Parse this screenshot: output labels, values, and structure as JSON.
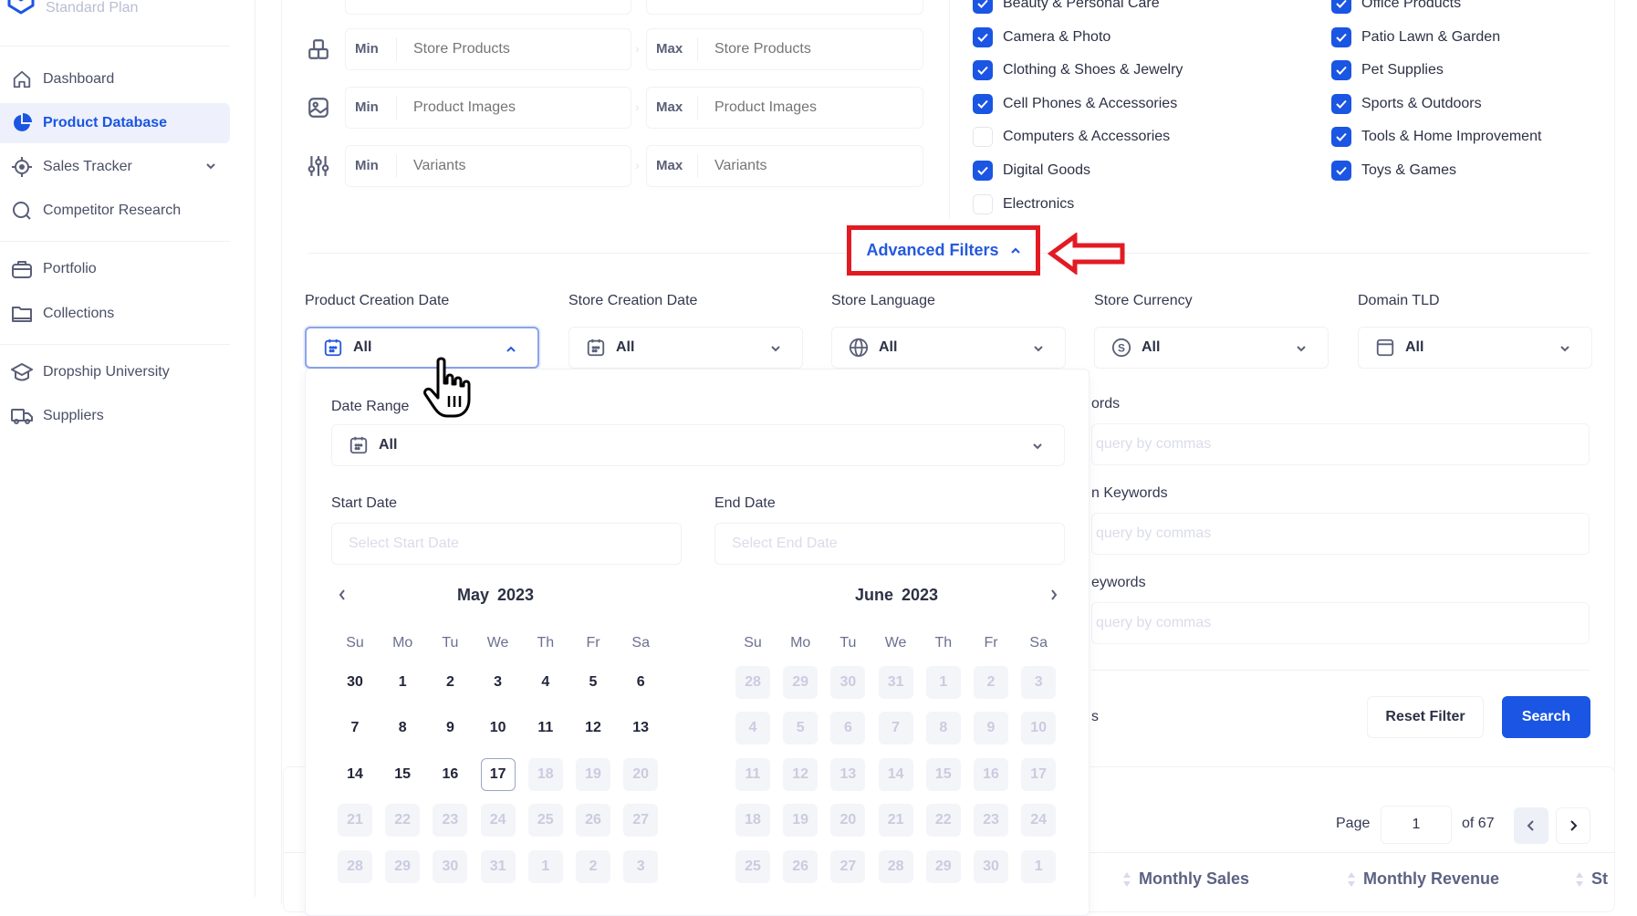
{
  "sidebar": {
    "plan": "Standard Plan",
    "items": [
      {
        "label": "Dashboard",
        "icon": "home-icon"
      },
      {
        "label": "Product Database",
        "icon": "pie-chart-icon",
        "active": true
      },
      {
        "label": "Sales Tracker",
        "icon": "target-icon",
        "expandable": true
      },
      {
        "label": "Competitor Research",
        "icon": "search-icon"
      },
      {
        "label": "Portfolio",
        "icon": "briefcase-icon"
      },
      {
        "label": "Collections",
        "icon": "folder-icon"
      },
      {
        "label": "Dropship University",
        "icon": "graduation-cap-icon"
      },
      {
        "label": "Suppliers",
        "icon": "truck-icon"
      }
    ]
  },
  "range_filters": [
    {
      "icon": "boxes-icon",
      "min_label": "Min",
      "min_placeholder": "Store Products",
      "max_label": "Max",
      "max_placeholder": "Store Products"
    },
    {
      "icon": "image-icon",
      "min_label": "Min",
      "min_placeholder": "Product Images",
      "max_label": "Max",
      "max_placeholder": "Product Images"
    },
    {
      "icon": "sliders-icon",
      "min_label": "Min",
      "min_placeholder": "Variants",
      "max_label": "Max",
      "max_placeholder": "Variants"
    }
  ],
  "categories": {
    "left": [
      {
        "label": "Beauty & Personal Care",
        "checked": true
      },
      {
        "label": "Camera & Photo",
        "checked": true
      },
      {
        "label": "Clothing & Shoes & Jewelry",
        "checked": true
      },
      {
        "label": "Cell Phones & Accessories",
        "checked": true
      },
      {
        "label": "Computers & Accessories",
        "checked": false
      },
      {
        "label": "Digital Goods",
        "checked": true
      },
      {
        "label": "Electronics",
        "checked": false
      }
    ],
    "right": [
      {
        "label": "Office Products",
        "checked": true
      },
      {
        "label": "Patio Lawn & Garden",
        "checked": true
      },
      {
        "label": "Pet Supplies",
        "checked": true
      },
      {
        "label": "Sports & Outdoors",
        "checked": true
      },
      {
        "label": "Tools & Home Improvement",
        "checked": true
      },
      {
        "label": "Toys & Games",
        "checked": true
      }
    ]
  },
  "advanced_filters": {
    "label": "Advanced Filters",
    "expanded": true,
    "highlight_color": "#e21b23"
  },
  "filters": [
    {
      "label": "Product Creation Date",
      "value": "All",
      "icon": "calendar-icon",
      "open": true
    },
    {
      "label": "Store Creation Date",
      "value": "All",
      "icon": "calendar-icon"
    },
    {
      "label": "Store Language",
      "value": "All",
      "icon": "globe-icon"
    },
    {
      "label": "Store Currency",
      "value": "All",
      "icon": "dollar-circle-icon"
    },
    {
      "label": "Domain TLD",
      "value": "All",
      "icon": "browser-window-icon"
    }
  ],
  "date_popover": {
    "range_label": "Date Range",
    "range_value": "All",
    "start_label": "Start Date",
    "start_placeholder": "Select Start Date",
    "end_label": "End Date",
    "end_placeholder": "Select End Date",
    "weekdays": [
      "Su",
      "Mo",
      "Tu",
      "We",
      "Th",
      "Fr",
      "Sa"
    ],
    "months": [
      {
        "title": "May  2023",
        "today": 17,
        "rows": [
          [
            {
              "d": "30",
              "s": "n"
            },
            {
              "d": "1",
              "s": "n"
            },
            {
              "d": "2",
              "s": "n"
            },
            {
              "d": "3",
              "s": "n"
            },
            {
              "d": "4",
              "s": "n"
            },
            {
              "d": "5",
              "s": "n"
            },
            {
              "d": "6",
              "s": "n"
            }
          ],
          [
            {
              "d": "7",
              "s": "n"
            },
            {
              "d": "8",
              "s": "n"
            },
            {
              "d": "9",
              "s": "n"
            },
            {
              "d": "10",
              "s": "n"
            },
            {
              "d": "11",
              "s": "n"
            },
            {
              "d": "12",
              "s": "n"
            },
            {
              "d": "13",
              "s": "n"
            }
          ],
          [
            {
              "d": "14",
              "s": "n"
            },
            {
              "d": "15",
              "s": "n"
            },
            {
              "d": "16",
              "s": "n"
            },
            {
              "d": "17",
              "s": "t"
            },
            {
              "d": "18",
              "s": "x"
            },
            {
              "d": "19",
              "s": "x"
            },
            {
              "d": "20",
              "s": "x"
            }
          ],
          [
            {
              "d": "21",
              "s": "x"
            },
            {
              "d": "22",
              "s": "x"
            },
            {
              "d": "23",
              "s": "x"
            },
            {
              "d": "24",
              "s": "x"
            },
            {
              "d": "25",
              "s": "x"
            },
            {
              "d": "26",
              "s": "x"
            },
            {
              "d": "27",
              "s": "x"
            }
          ],
          [
            {
              "d": "28",
              "s": "x"
            },
            {
              "d": "29",
              "s": "x"
            },
            {
              "d": "30",
              "s": "x"
            },
            {
              "d": "31",
              "s": "x"
            },
            {
              "d": "1",
              "s": "x"
            },
            {
              "d": "2",
              "s": "x"
            },
            {
              "d": "3",
              "s": "x"
            }
          ]
        ]
      },
      {
        "title": "June  2023",
        "rows": [
          [
            {
              "d": "28",
              "s": "x"
            },
            {
              "d": "29",
              "s": "x"
            },
            {
              "d": "30",
              "s": "x"
            },
            {
              "d": "31",
              "s": "x"
            },
            {
              "d": "1",
              "s": "x"
            },
            {
              "d": "2",
              "s": "x"
            },
            {
              "d": "3",
              "s": "x"
            }
          ],
          [
            {
              "d": "4",
              "s": "x"
            },
            {
              "d": "5",
              "s": "x"
            },
            {
              "d": "6",
              "s": "x"
            },
            {
              "d": "7",
              "s": "x"
            },
            {
              "d": "8",
              "s": "x"
            },
            {
              "d": "9",
              "s": "x"
            },
            {
              "d": "10",
              "s": "x"
            }
          ],
          [
            {
              "d": "11",
              "s": "x"
            },
            {
              "d": "12",
              "s": "x"
            },
            {
              "d": "13",
              "s": "x"
            },
            {
              "d": "14",
              "s": "x"
            },
            {
              "d": "15",
              "s": "x"
            },
            {
              "d": "16",
              "s": "x"
            },
            {
              "d": "17",
              "s": "x"
            }
          ],
          [
            {
              "d": "18",
              "s": "x"
            },
            {
              "d": "19",
              "s": "x"
            },
            {
              "d": "20",
              "s": "x"
            },
            {
              "d": "21",
              "s": "x"
            },
            {
              "d": "22",
              "s": "x"
            },
            {
              "d": "23",
              "s": "x"
            },
            {
              "d": "24",
              "s": "x"
            }
          ],
          [
            {
              "d": "25",
              "s": "x"
            },
            {
              "d": "26",
              "s": "x"
            },
            {
              "d": "27",
              "s": "x"
            },
            {
              "d": "28",
              "s": "x"
            },
            {
              "d": "29",
              "s": "x"
            },
            {
              "d": "30",
              "s": "x"
            },
            {
              "d": "1",
              "s": "x"
            }
          ]
        ]
      }
    ]
  },
  "keywords": {
    "fields": [
      {
        "label_partial": "ords",
        "placeholder": "query by commas"
      },
      {
        "label_partial": "n Keywords",
        "placeholder": "query by commas"
      },
      {
        "label_partial": "eywords",
        "placeholder": "query by commas"
      }
    ],
    "trailing_label_partial": "s",
    "reset_label": "Reset Filter",
    "search_label": "Search"
  },
  "pagination": {
    "page_label": "Page",
    "current_page": "1",
    "of_label": "of 67"
  },
  "table_headers": [
    "Monthly Sales",
    "Monthly Revenue",
    "St"
  ],
  "colors": {
    "brand": "#1a55e3",
    "annotation": "#e21b23"
  }
}
